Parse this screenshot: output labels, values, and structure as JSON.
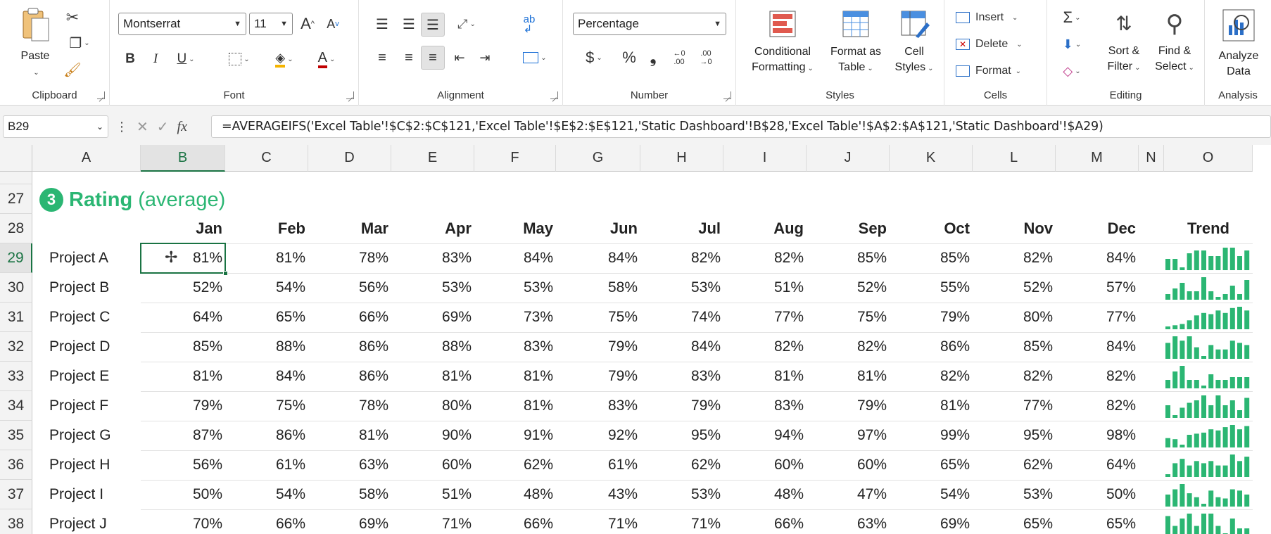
{
  "ribbon": {
    "clipboard": {
      "label": "Clipboard",
      "paste_label": "Paste"
    },
    "font": {
      "label": "Font",
      "font_name": "Montserrat",
      "font_size": "11",
      "bold": "B",
      "italic": "I",
      "underline": "U",
      "font_color_glyph": "A",
      "grow_glyph": "A",
      "shrink_glyph": "A"
    },
    "alignment": {
      "label": "Alignment"
    },
    "number": {
      "label": "Number",
      "format": "Percentage",
      "currency": "$",
      "percent": "%",
      "comma": "❟",
      "inc_decimal": "←0\n.00",
      "dec_decimal": ".00\n→0"
    },
    "styles": {
      "label": "Styles",
      "conditional": [
        "Conditional",
        "Formatting"
      ],
      "format_table": [
        "Format as",
        "Table"
      ],
      "cell_styles": [
        "Cell",
        "Styles"
      ]
    },
    "cells": {
      "label": "Cells",
      "insert": "Insert",
      "delete": "Delete",
      "format": "Format"
    },
    "editing": {
      "label": "Editing",
      "sort": [
        "Sort &",
        "Filter"
      ],
      "find": [
        "Find &",
        "Select"
      ]
    },
    "analysis": {
      "label": "Analysis",
      "analyze": [
        "Analyze",
        "Data"
      ]
    }
  },
  "formula_bar": {
    "name_box": "B29",
    "formula": "=AVERAGEIFS('Excel Table'!$C$2:$C$121,'Excel Table'!$E$2:$E$121,'Static Dashboard'!B$28,'Excel Table'!$A$2:$A$121,'Static Dashboard'!$A29)"
  },
  "sheet": {
    "columns": [
      "A",
      "B",
      "C",
      "D",
      "E",
      "F",
      "G",
      "H",
      "I",
      "J",
      "K",
      "L",
      "M",
      "N",
      "O"
    ],
    "active_column": "B",
    "rows": [
      "27",
      "28",
      "29",
      "30",
      "31",
      "32",
      "33",
      "34",
      "35",
      "36",
      "37",
      "38"
    ],
    "active_row": "29",
    "section_number": "3",
    "section_title": "Rating",
    "section_subtitle": "(average)",
    "months": [
      "Jan",
      "Feb",
      "Mar",
      "Apr",
      "May",
      "Jun",
      "Jul",
      "Aug",
      "Sep",
      "Oct",
      "Nov",
      "Dec"
    ],
    "trend_label": "Trend",
    "trend_color": "#2bb673",
    "projects": [
      {
        "name": "Project A",
        "values": [
          "81%",
          "81%",
          "78%",
          "83%",
          "84%",
          "84%",
          "82%",
          "82%",
          "85%",
          "85%",
          "82%",
          "84%"
        ]
      },
      {
        "name": "Project B",
        "values": [
          "52%",
          "54%",
          "56%",
          "53%",
          "53%",
          "58%",
          "53%",
          "51%",
          "52%",
          "55%",
          "52%",
          "57%"
        ]
      },
      {
        "name": "Project C",
        "values": [
          "64%",
          "65%",
          "66%",
          "69%",
          "73%",
          "75%",
          "74%",
          "77%",
          "75%",
          "79%",
          "80%",
          "77%"
        ]
      },
      {
        "name": "Project D",
        "values": [
          "85%",
          "88%",
          "86%",
          "88%",
          "83%",
          "79%",
          "84%",
          "82%",
          "82%",
          "86%",
          "85%",
          "84%"
        ]
      },
      {
        "name": "Project E",
        "values": [
          "81%",
          "84%",
          "86%",
          "81%",
          "81%",
          "79%",
          "83%",
          "81%",
          "81%",
          "82%",
          "82%",
          "82%"
        ]
      },
      {
        "name": "Project F",
        "values": [
          "79%",
          "75%",
          "78%",
          "80%",
          "81%",
          "83%",
          "79%",
          "83%",
          "79%",
          "81%",
          "77%",
          "82%"
        ]
      },
      {
        "name": "Project G",
        "values": [
          "87%",
          "86%",
          "81%",
          "90%",
          "91%",
          "92%",
          "95%",
          "94%",
          "97%",
          "99%",
          "95%",
          "98%"
        ]
      },
      {
        "name": "Project H",
        "values": [
          "56%",
          "61%",
          "63%",
          "60%",
          "62%",
          "61%",
          "62%",
          "60%",
          "60%",
          "65%",
          "62%",
          "64%"
        ]
      },
      {
        "name": "Project I",
        "values": [
          "50%",
          "54%",
          "58%",
          "51%",
          "48%",
          "43%",
          "53%",
          "48%",
          "47%",
          "54%",
          "53%",
          "50%"
        ]
      },
      {
        "name": "Project J",
        "values": [
          "70%",
          "66%",
          "69%",
          "71%",
          "66%",
          "71%",
          "71%",
          "66%",
          "63%",
          "69%",
          "65%",
          "65%"
        ]
      }
    ]
  }
}
